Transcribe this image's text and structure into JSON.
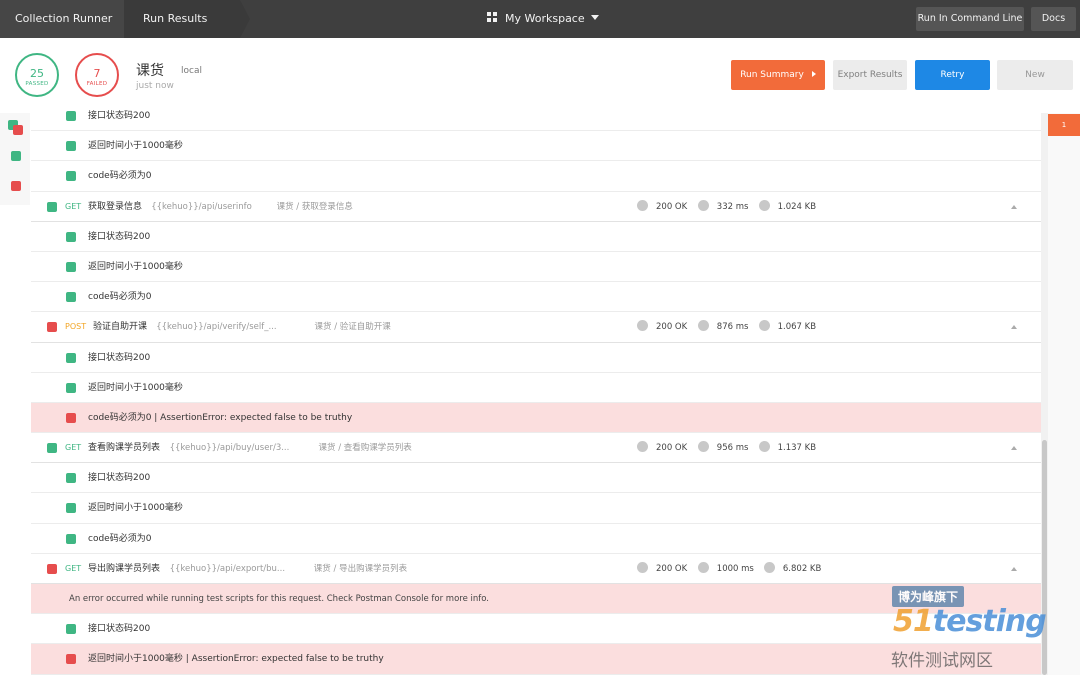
{
  "topbar": {
    "crumb1": "Collection Runner",
    "crumb2": "Run Results",
    "workspace": "My Workspace",
    "run_cmd": "Run In Command Line",
    "docs": "Docs"
  },
  "header": {
    "passed_count": "25",
    "passed_label": "PASSED",
    "failed_count": "7",
    "failed_label": "FAILED",
    "run_name": "课货",
    "environment": "local",
    "time": "just now",
    "run_summary": "Run Summary",
    "export_results": "Export Results",
    "retry": "Retry",
    "new": "New"
  },
  "right_badge": "1",
  "colors": {
    "pass": "#3fb683",
    "fail": "#e64d4d",
    "accent": "#f26b3a",
    "retry": "#1e88e5"
  },
  "rows": [
    {
      "kind": "test",
      "status": "pass",
      "text": "接口状态码200"
    },
    {
      "kind": "test",
      "status": "pass",
      "text": "返回时间小于1000毫秒"
    },
    {
      "kind": "test",
      "status": "pass",
      "text": "code码必须为0"
    },
    {
      "kind": "request",
      "status": "pass",
      "method": "GET",
      "name": "获取登录信息",
      "url": "{{kehuo}}/api/userinfo",
      "path": "课货 / 获取登录信息",
      "code": "200 OK",
      "time": "332 ms",
      "size": "1.024 KB"
    },
    {
      "kind": "test",
      "status": "pass",
      "text": "接口状态码200"
    },
    {
      "kind": "test",
      "status": "pass",
      "text": "返回时间小于1000毫秒"
    },
    {
      "kind": "test",
      "status": "pass",
      "text": "code码必须为0"
    },
    {
      "kind": "request",
      "status": "fail",
      "method": "POST",
      "name": "验证自助开课",
      "url": "{{kehuo}}/api/verify/self_...",
      "path": "课货 / 验证自助开课",
      "code": "200 OK",
      "time": "876 ms",
      "size": "1.067 KB"
    },
    {
      "kind": "test",
      "status": "pass",
      "text": "接口状态码200"
    },
    {
      "kind": "test",
      "status": "pass",
      "text": "返回时间小于1000毫秒"
    },
    {
      "kind": "test",
      "status": "fail",
      "text": "code码必须为0 | AssertionError: expected false to be truthy"
    },
    {
      "kind": "request",
      "status": "pass",
      "method": "GET",
      "name": "查看购课学员列表",
      "url": "{{kehuo}}/api/buy/user/3...",
      "path": "课货 / 查看购课学员列表",
      "code": "200 OK",
      "time": "956 ms",
      "size": "1.137 KB"
    },
    {
      "kind": "test",
      "status": "pass",
      "text": "接口状态码200"
    },
    {
      "kind": "test",
      "status": "pass",
      "text": "返回时间小于1000毫秒"
    },
    {
      "kind": "test",
      "status": "pass",
      "text": "code码必须为0"
    },
    {
      "kind": "request",
      "status": "fail",
      "method": "GET",
      "name": "导出购课学员列表",
      "url": "{{kehuo}}/api/export/bu...",
      "path": "课货 / 导出购课学员列表",
      "code": "200 OK",
      "time": "1000 ms",
      "size": "6.802 KB"
    },
    {
      "kind": "error",
      "text": "An error occurred while running test scripts for this request. Check Postman Console for more info."
    },
    {
      "kind": "test",
      "status": "pass",
      "text": "接口状态码200"
    },
    {
      "kind": "test",
      "status": "fail",
      "text": "返回时间小于1000毫秒 | AssertionError: expected false to be truthy"
    }
  ],
  "watermark": {
    "line1": "博为峰旗下",
    "line2a": "51",
    "line2b": "testing",
    "line3": "软件测试网区"
  }
}
